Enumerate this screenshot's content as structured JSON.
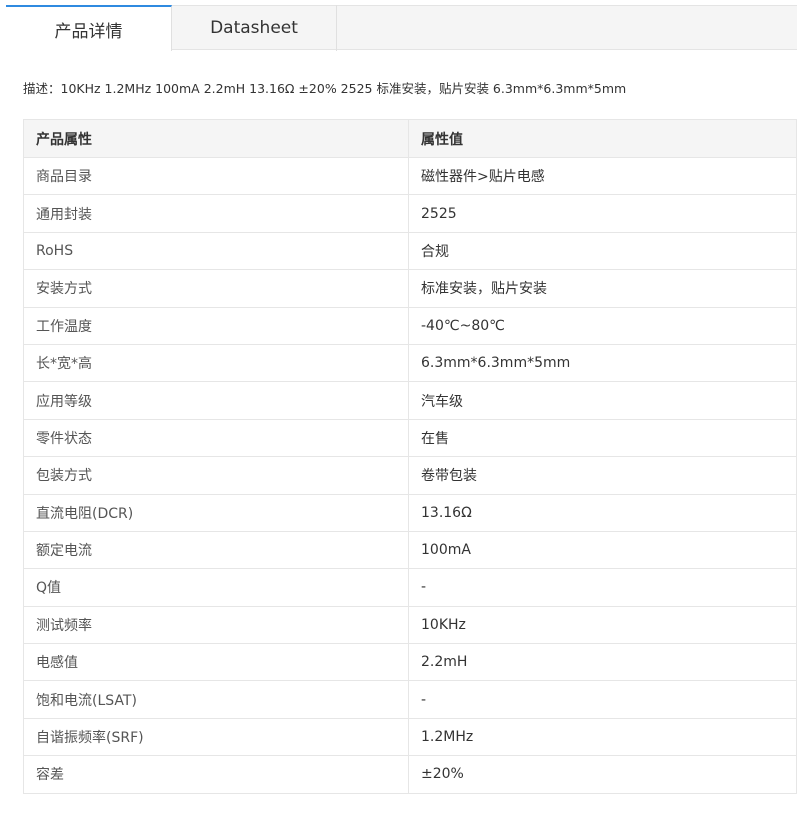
{
  "tabs": [
    {
      "label": "产品详情"
    },
    {
      "label": "Datasheet"
    }
  ],
  "description": "描述：10KHz 1.2MHz 100mA 2.2mH 13.16Ω ±20% 2525 标准安装，贴片安装 6.3mm*6.3mm*5mm",
  "table": {
    "headers": [
      "产品属性",
      "属性值"
    ],
    "rows": [
      {
        "key": "商品目录",
        "value": "磁性器件>贴片电感"
      },
      {
        "key": "通用封装",
        "value": "2525"
      },
      {
        "key": "RoHS",
        "value": "合规"
      },
      {
        "key": "安装方式",
        "value": "标准安装，贴片安装"
      },
      {
        "key": "工作温度",
        "value": "-40℃~80℃"
      },
      {
        "key": "长*宽*高",
        "value": "6.3mm*6.3mm*5mm"
      },
      {
        "key": "应用等级",
        "value": "汽车级"
      },
      {
        "key": "零件状态",
        "value": "在售"
      },
      {
        "key": "包装方式",
        "value": "卷带包装"
      },
      {
        "key": "直流电阻(DCR)",
        "value": "13.16Ω"
      },
      {
        "key": "额定电流",
        "value": "100mA"
      },
      {
        "key": "Q值",
        "value": "-"
      },
      {
        "key": "测试频率",
        "value": "10KHz"
      },
      {
        "key": "电感值",
        "value": "2.2mH"
      },
      {
        "key": "饱和电流(LSAT)",
        "value": "-"
      },
      {
        "key": "自谐振频率(SRF)",
        "value": "1.2MHz"
      },
      {
        "key": "容差",
        "value": "±20%"
      }
    ]
  }
}
